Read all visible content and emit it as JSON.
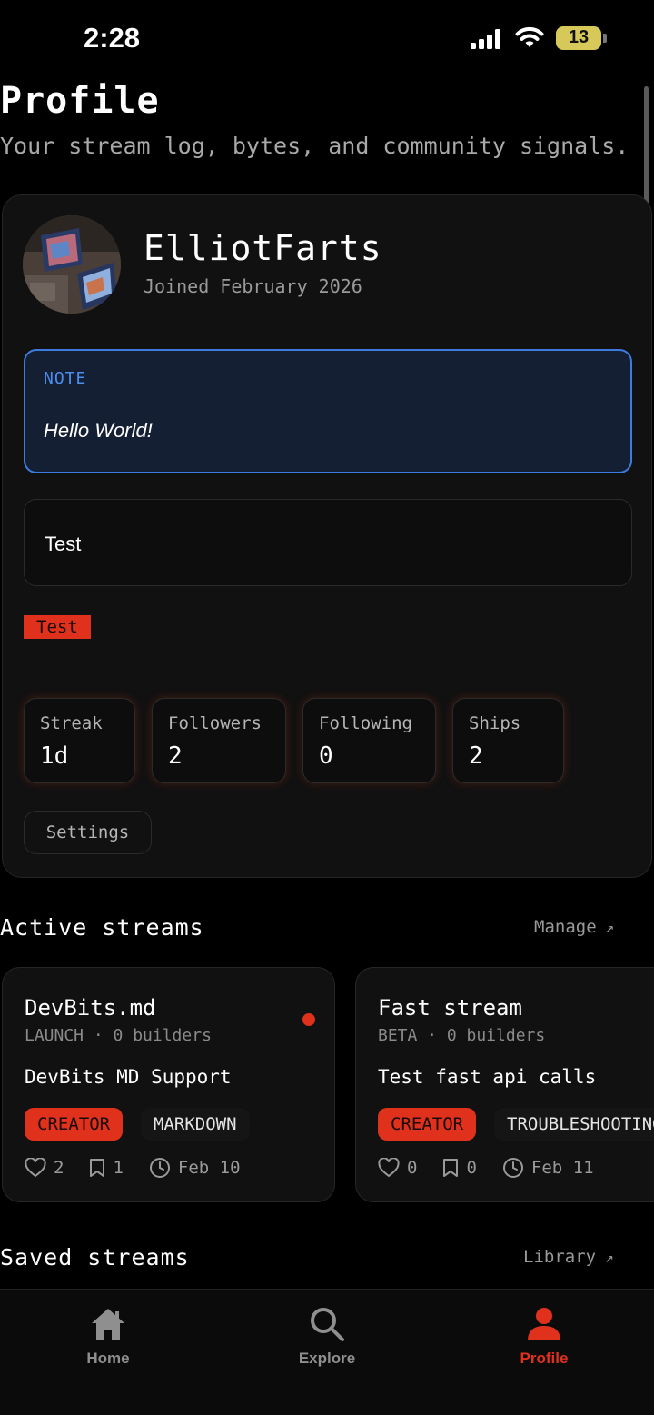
{
  "status_bar": {
    "time": "2:28",
    "battery": "13",
    "battery_level_percent": 13,
    "signal_bars": 4,
    "icons": [
      "cellular-signal-icon",
      "wifi-icon",
      "battery-icon"
    ]
  },
  "header": {
    "title": "Profile",
    "subtitle": "Your stream log, bytes, and community signals."
  },
  "profile": {
    "username": "ElliotFarts",
    "joined": "Joined February 2026",
    "note": {
      "label": "NOTE",
      "text": "Hello World!"
    },
    "bio": "Test",
    "tag": "Test",
    "stats": [
      {
        "label": "Streak",
        "value": "1d"
      },
      {
        "label": "Followers",
        "value": "2"
      },
      {
        "label": "Following",
        "value": "0"
      },
      {
        "label": "Ships",
        "value": "2"
      }
    ],
    "settings_label": "Settings"
  },
  "active_streams": {
    "title": "Active streams",
    "link": "Manage",
    "items": [
      {
        "title": "DevBits.md",
        "meta": "LAUNCH · 0 builders",
        "description": "DevBits MD Support",
        "role": "CREATOR",
        "topic": "MARKDOWN",
        "likes": "2",
        "saves": "1",
        "date": "Feb 10",
        "live": true
      },
      {
        "title": "Fast stream",
        "meta": "BETA · 0 builders",
        "description": "Test fast api calls",
        "role": "CREATOR",
        "topic": "TROUBLESHOOTING",
        "likes": "0",
        "saves": "0",
        "date": "Feb 11",
        "live": false
      }
    ]
  },
  "saved_streams": {
    "title": "Saved streams",
    "link": "Library"
  },
  "tabbar": {
    "active": "Profile",
    "accent": "#e0311d",
    "items": [
      {
        "label": "Home",
        "icon": "home-icon"
      },
      {
        "label": "Explore",
        "icon": "search-icon"
      },
      {
        "label": "Profile",
        "icon": "person-icon"
      }
    ]
  }
}
